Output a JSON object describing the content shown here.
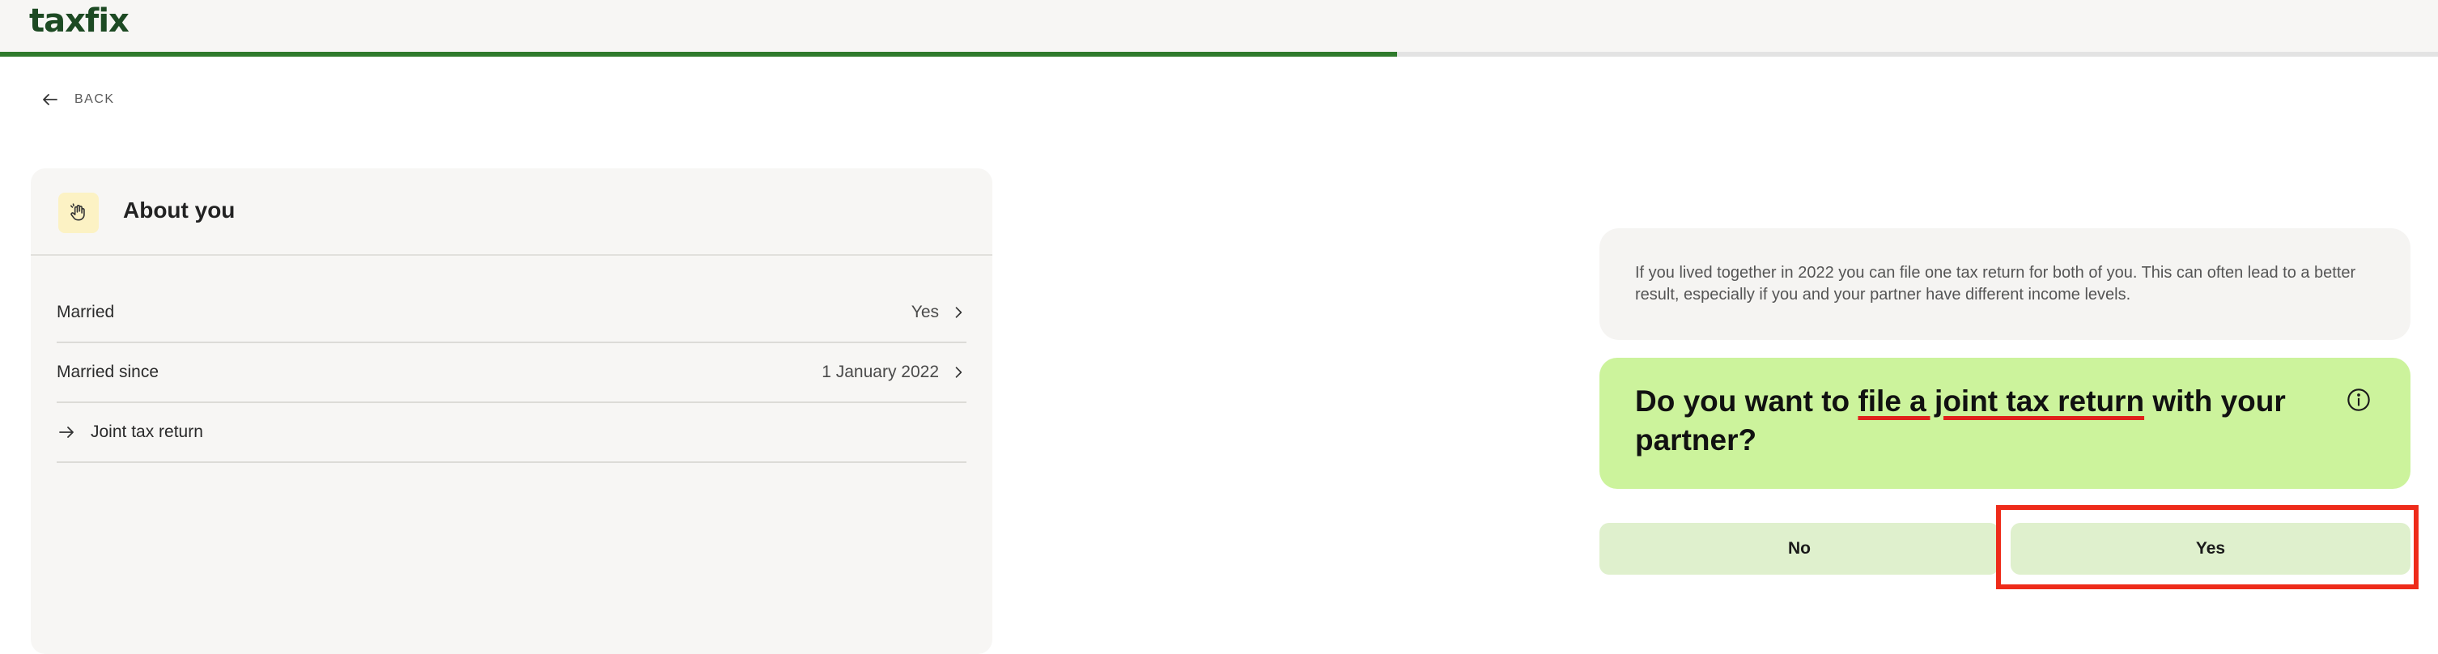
{
  "brand": {
    "logo_text": "taxfix",
    "color": "#1d4a23"
  },
  "progress": {
    "fraction": 0.573,
    "fill_color": "#2f7a2c"
  },
  "nav": {
    "back_label": "BACK",
    "back_icon": "arrow-left-icon"
  },
  "summary": {
    "icon": "waving-hand-icon",
    "title": "About you",
    "rows": [
      {
        "label": "Married",
        "value": "Yes",
        "icon": "chevron-right-icon"
      },
      {
        "label": "Married since",
        "value": "1 January 2022",
        "icon": "chevron-right-icon"
      },
      {
        "label": "Joint tax return",
        "icon": "arrow-right-icon"
      }
    ]
  },
  "info": {
    "text": "If you lived together in 2022 you can file one tax return for both of you. This can often lead to a better result, especially if you and your partner have different income levels."
  },
  "question": {
    "prefix": "Do you want to ",
    "highlight": "file a joint tax return",
    "suffix": " with your partner?",
    "icon": "info-icon",
    "background": "#ccf39c"
  },
  "answers": {
    "no_label": "No",
    "yes_label": "Yes",
    "button_color": "#dff0cd"
  },
  "annotation": {
    "highlight_color": "#ee2b1a"
  }
}
